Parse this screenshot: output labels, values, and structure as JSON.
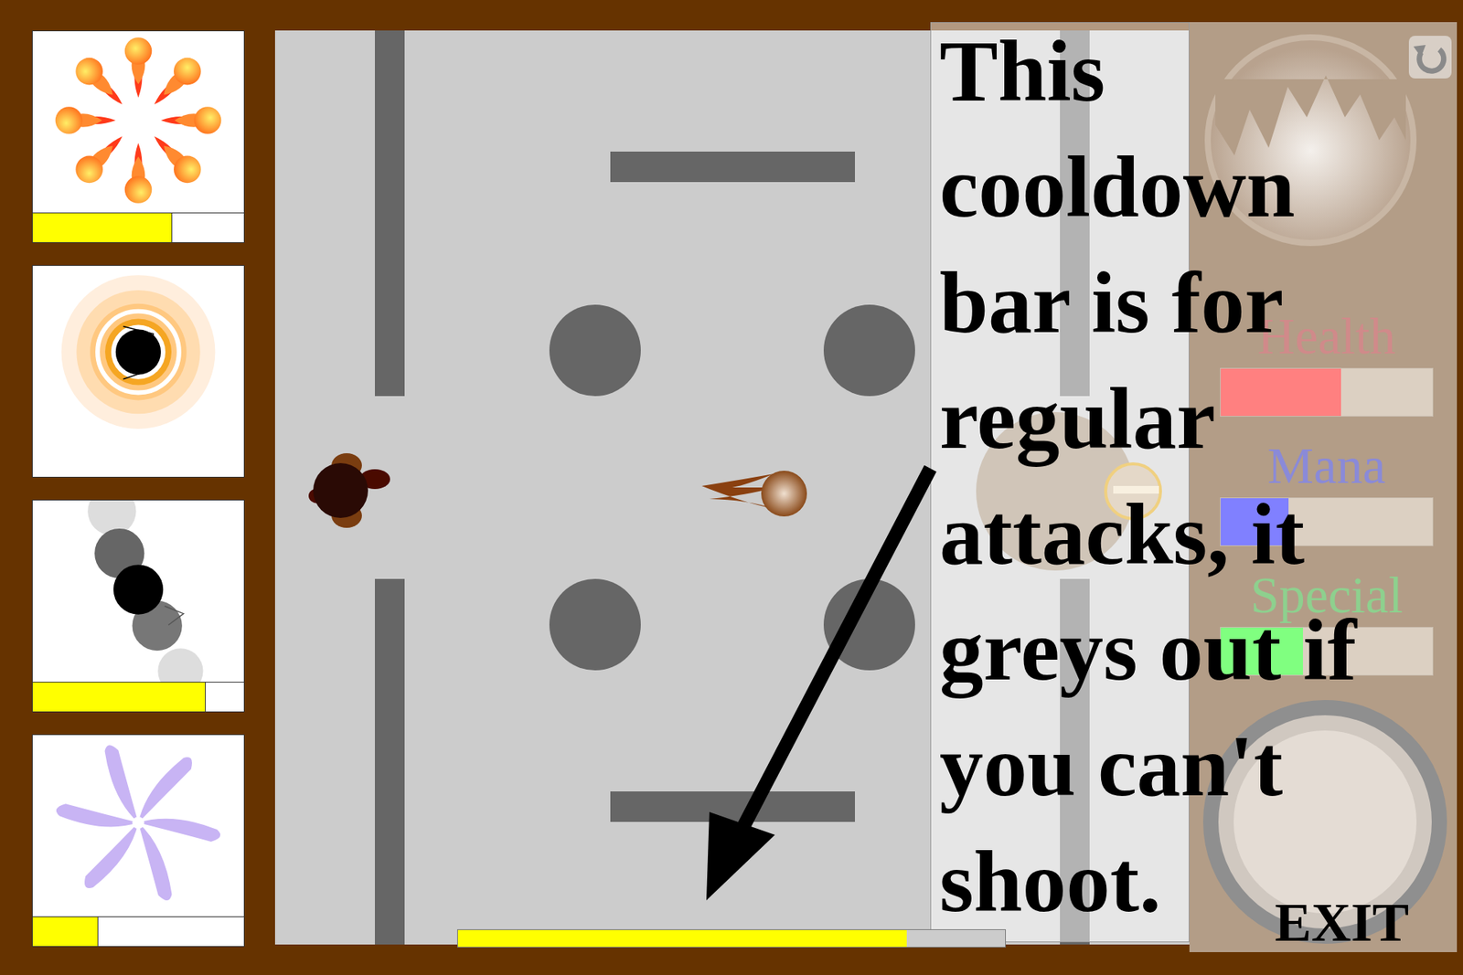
{
  "ability_cards": [
    {
      "kind": "bar",
      "level": 0.66
    },
    {
      "kind": "none"
    },
    {
      "kind": "bar",
      "level": 0.82
    },
    {
      "kind": "bar",
      "level": 0.31
    }
  ],
  "attack_cooldown": {
    "level": 0.82,
    "disabled": false
  },
  "hud": {
    "stats": [
      {
        "label": "Health",
        "level": 0.57,
        "color": "#ff8080"
      },
      {
        "label": "Mana",
        "level": 0.32,
        "color": "#8080ff"
      },
      {
        "label": "Special",
        "level": 0.39,
        "color": "#80ff80"
      }
    ],
    "exit_button": "EXIT"
  },
  "tutorial": {
    "lines": [
      "This",
      "cooldown",
      "bar is for",
      "regular",
      "attacks, it",
      "greys out if",
      "you can't",
      "shoot."
    ]
  }
}
